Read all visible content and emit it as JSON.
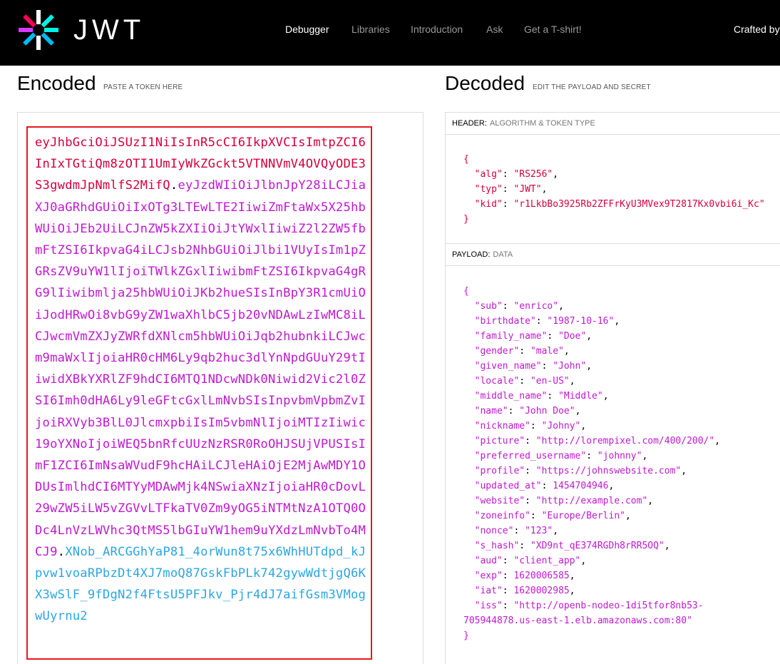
{
  "nav": {
    "brand": "JWT",
    "items": [
      "Debugger",
      "Libraries",
      "Introduction",
      "Ask",
      "Get a T-shirt!"
    ],
    "active": "Debugger",
    "crafted": "Crafted by"
  },
  "encoded": {
    "title": "Encoded",
    "subtitle": "PASTE A TOKEN HERE",
    "header": "eyJhbGciOiJSUzI1NiIsInR5cCI6IkpXVCIsImtpZCI6InIxTGtiQm8zOTI1UmIyWkZGckt5VTNNVmV4OVQyODE3S3gwdmJpNmlfS2MifQ",
    "payload": "eyJzdWIiOiJlbnJpY28iLCJiaXJ0aGRhdGUiOiIxOTg3LTEwLTE2IiwiZmFtaWx5X25hbWUiOiJEb2UiLCJnZW5kZXIiOiJtYWxlIiwiZ2l2ZW5fbmFtZSI6IkpvaG4iLCJsb2NhbGUiOiJlbi1VUyIsIm1pZGRsZV9uYW1lIjoiTWlkZGxlIiwibmFtZSI6IkpvaG4gRG9lIiwibmlja25hbWUiOiJKb2hueSIsInBpY3R1cmUiOiJodHRwOi8vbG9yZW1waXhlbC5jb20vNDAwLzIwMC8iLCJwcmVmZXJyZWRfdXNlcm5hbWUiOiJqb2hubnkiLCJwcm9maWxlIjoiaHR0cHM6Ly9qb2huc3dlYnNpdGUuY29tIiwidXBkYXRlZF9hdCI6MTQ1NDcwNDk0Niwid2Vic2l0ZSI6Imh0dHA6Ly9leGFtcGxlLmNvbSIsInpvbmVpbmZvIjoiRXVyb3BlL0JlcmxpbiIsIm5vbmNlIjoiMTIzIiwic19oYXNoIjoiWEQ5bnRfcUUzNzRSR0RoOHJSUjVPUSIsImF1ZCI6ImNsaWVudF9hcHAiLCJleHAiOjE2MjAwMDY1ODUsImlhdCI6MTYyMDAwMjk4NSwiaXNzIjoiaHR0cDovL29wZW5iLW5vZGVvLTFkaTV0Zm9yOG5iNTMtNzA1OTQ0ODc4LnVzLWVhc3QtMS5lbGIuYW1hem9uYXdzLmNvbTo4MCJ9",
    "signature": "XNob_ARCGGhYaP81_4orWun8t75x6WhHUTdpd_kJpvw1voaRPbzDt4XJ7moQ87GskFbPLk742gywWdtjgQ6KX3wSlF_9fDgN2f4FtsU5PFJkv_Pjr4dJ7aifGsm3VMogwUyrnu2"
  },
  "decoded": {
    "title": "Decoded",
    "subtitle": "EDIT THE PAYLOAD AND SECRET",
    "header_label": "HEADER:",
    "header_sub": "ALGORITHM & TOKEN TYPE",
    "header_json": [
      [
        "alg",
        "\"RS256\""
      ],
      [
        "typ",
        "\"JWT\""
      ],
      [
        "kid",
        "\"r1LkbBo3925Rb2ZFFrKyU3MVex9T2817Kx0vbi6i_Kc\""
      ]
    ],
    "payload_label": "PAYLOAD:",
    "payload_sub": "DATA",
    "payload_json": [
      [
        "sub",
        "\"enrico\""
      ],
      [
        "birthdate",
        "\"1987-10-16\""
      ],
      [
        "family_name",
        "\"Doe\""
      ],
      [
        "gender",
        "\"male\""
      ],
      [
        "given_name",
        "\"John\""
      ],
      [
        "locale",
        "\"en-US\""
      ],
      [
        "middle_name",
        "\"Middle\""
      ],
      [
        "name",
        "\"John Doe\""
      ],
      [
        "nickname",
        "\"Johny\""
      ],
      [
        "picture",
        "\"http://lorempixel.com/400/200/\""
      ],
      [
        "preferred_username",
        "\"johnny\""
      ],
      [
        "profile",
        "\"https://johnswebsite.com\""
      ],
      [
        "updated_at",
        "1454704946"
      ],
      [
        "website",
        "\"http://example.com\""
      ],
      [
        "zoneinfo",
        "\"Europe/Berlin\""
      ],
      [
        "nonce",
        "\"123\""
      ],
      [
        "s_hash",
        "\"XD9nt_qE374RGDh8rRR5OQ\""
      ],
      [
        "aud",
        "\"client_app\""
      ],
      [
        "exp",
        "1620006585"
      ],
      [
        "iat",
        "1620002985"
      ],
      [
        "iss",
        "\"http://openb-nodeo-1di5tfor8nb53-\n705944878.us-east-1.elb.amazonaws.com:80\""
      ]
    ]
  },
  "colors": {
    "header": "#d6003c",
    "payload": "#c019d1",
    "signature": "#2ca6e3",
    "highlight_border": "#e6191d"
  }
}
